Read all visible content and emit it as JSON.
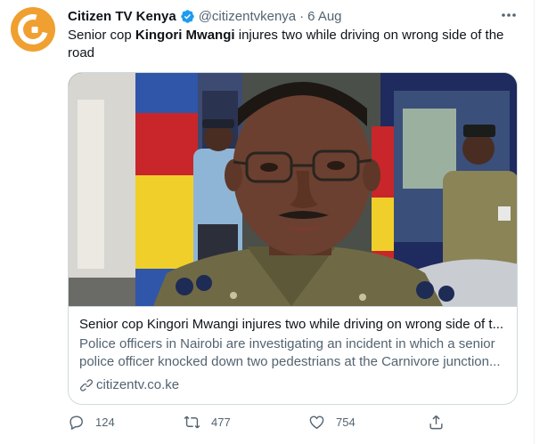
{
  "author": {
    "name": "Citizen TV Kenya",
    "handle": "@citizentvkenya",
    "separator": "·",
    "date": "6 Aug"
  },
  "tweet": {
    "text_before": "Senior cop ",
    "text_bold": "Kingori Mwangi",
    "text_after": " injures two while driving on wrong side of the road"
  },
  "card": {
    "title": "Senior cop Kingori Mwangi injures two while driving on wrong side of t...",
    "description": "Police officers in Nairobi are investigating an incident in which a senior police officer knocked down two pedestrians at the Carnivore junction...",
    "domain": "citizentv.co.ke"
  },
  "actions": {
    "replies": "124",
    "retweets": "477",
    "likes": "754"
  },
  "icons": {
    "verified": "verified-badge-icon",
    "more": "more-icon",
    "reply": "reply-icon",
    "retweet": "retweet-icon",
    "like": "like-icon",
    "share": "share-icon",
    "link": "link-icon"
  },
  "colors": {
    "verified": "#1d9bf0",
    "secondary_text": "#536471",
    "avatar": "#f0a030",
    "border": "#cfd9de"
  }
}
